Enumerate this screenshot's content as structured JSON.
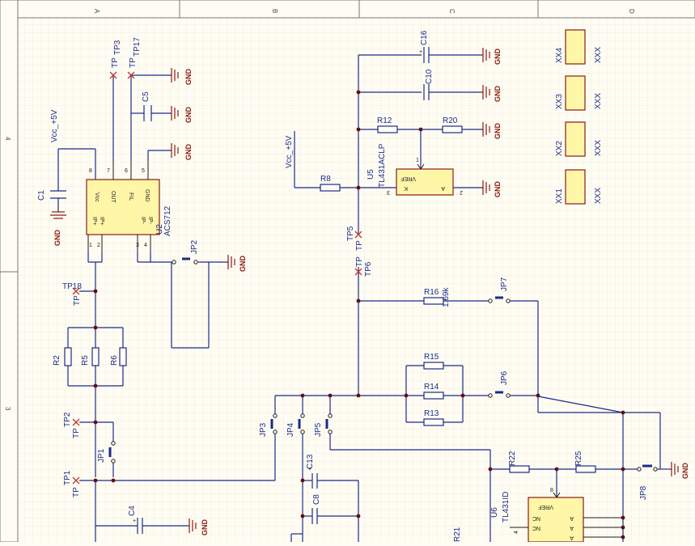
{
  "zones": {
    "top": [
      "A",
      "B",
      "C",
      "D"
    ],
    "left": [
      "4",
      "3"
    ]
  },
  "labels": {
    "vcc_left": "Vcc_+5V",
    "vcc_mid": "Vcc_+5V",
    "gnd": "GND",
    "tp": "TP"
  },
  "components": {
    "c1": "C1",
    "c4": "C4",
    "c5": "C5",
    "c8": "C8",
    "c10": "C10",
    "c13": "C13",
    "c16": "C16",
    "r2": "R2",
    "r5": "R5",
    "r6": "R6",
    "r8": "R8",
    "r12": "R12",
    "r13": "R13",
    "r14": "R14",
    "r15": "R15",
    "r16": "R16",
    "r16_value": "1.69k",
    "r20": "R20",
    "r21": "R21",
    "r22": "R22",
    "r25": "R25",
    "tp1": "TP1",
    "tp2": "TP2",
    "tp3": "TP3",
    "tp5": "TP5",
    "tp6": "TP6",
    "tp17": "TP17",
    "tp18": "TP18",
    "jp1": "JP1",
    "jp2": "JP2",
    "jp3": "JP3",
    "jp4": "JP4",
    "jp5": "JP5",
    "jp6": "JP6",
    "jp7": "JP7",
    "jp8": "JP8",
    "xx1": "XX1",
    "xx2": "XX2",
    "xx3": "XX3",
    "xx4": "XX4",
    "xx_value": "XXX"
  },
  "u2": {
    "ref": "U2",
    "part": "ACS712",
    "pins": {
      "vcc": "Vcc",
      "out": "OUT",
      "fil": "FIL",
      "gnd": "GND",
      "ip_plus": "IP+",
      "ip_minus": "IP-"
    },
    "numbers": [
      "8",
      "7",
      "6",
      "5",
      "1",
      "2",
      "3",
      "4"
    ]
  },
  "u5": {
    "ref": "U5",
    "part": "TL431ACLP",
    "vref": "VREF",
    "k": "K",
    "a": "A",
    "numbers": [
      "1",
      "3",
      "2"
    ]
  },
  "u6": {
    "ref": "U6",
    "part": "TL431ID",
    "vref": "VREF",
    "nc": "NC",
    "a": "A",
    "numbers": [
      "8",
      "4"
    ]
  }
}
